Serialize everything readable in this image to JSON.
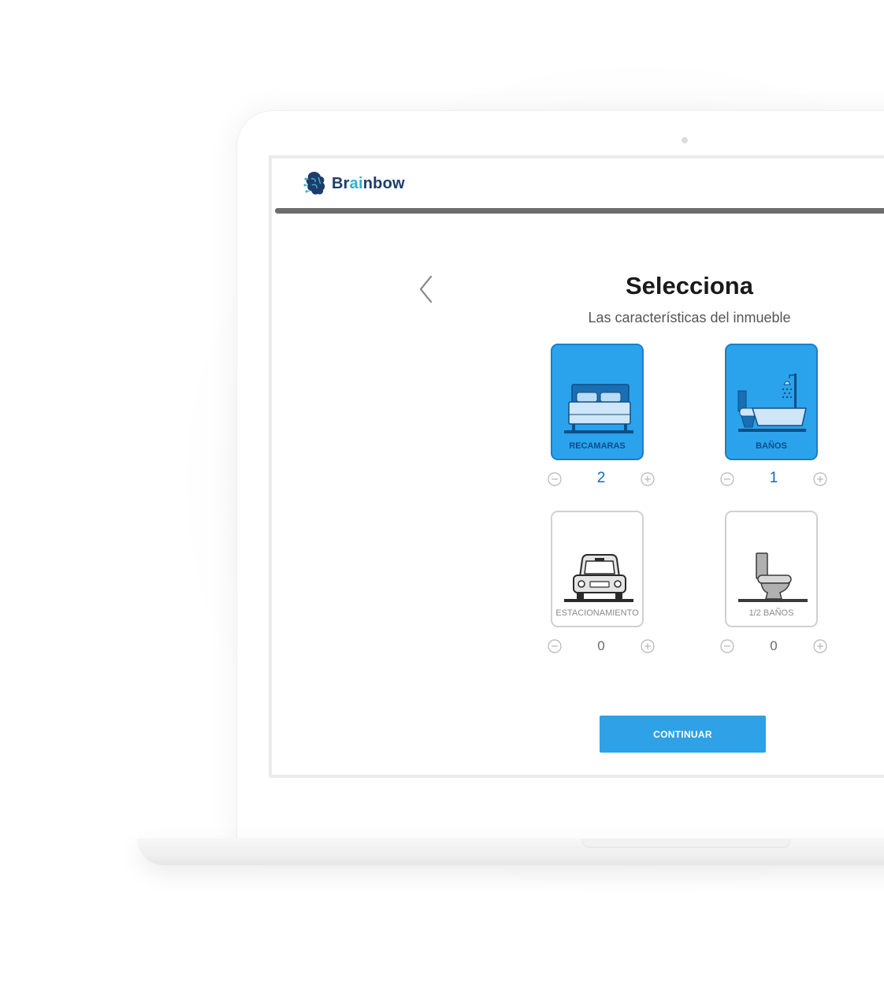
{
  "brand": {
    "name_prefix": "Br",
    "name_highlight": "ai",
    "name_suffix": "nbow"
  },
  "progress": {
    "fraction": 0.98
  },
  "heading": {
    "title": "Selecciona",
    "subtitle": "Las características del inmueble"
  },
  "features": [
    {
      "label": "RECAMARAS",
      "value": "2",
      "selected": true,
      "icon": "bed-icon"
    },
    {
      "label": "BAÑOS",
      "value": "1",
      "selected": true,
      "icon": "bathtub-icon"
    },
    {
      "label": "ESTACIONAMIENTO",
      "value": "0",
      "selected": false,
      "icon": "car-icon"
    },
    {
      "label": "1/2 BAÑOS",
      "value": "0",
      "selected": false,
      "icon": "toilet-icon"
    }
  ],
  "actions": {
    "continue_label": "CONTINUAR"
  },
  "colors": {
    "accent": "#2aa3ec",
    "brand": "#1f3c6b",
    "brand_highlight": "#2eb0c8"
  }
}
